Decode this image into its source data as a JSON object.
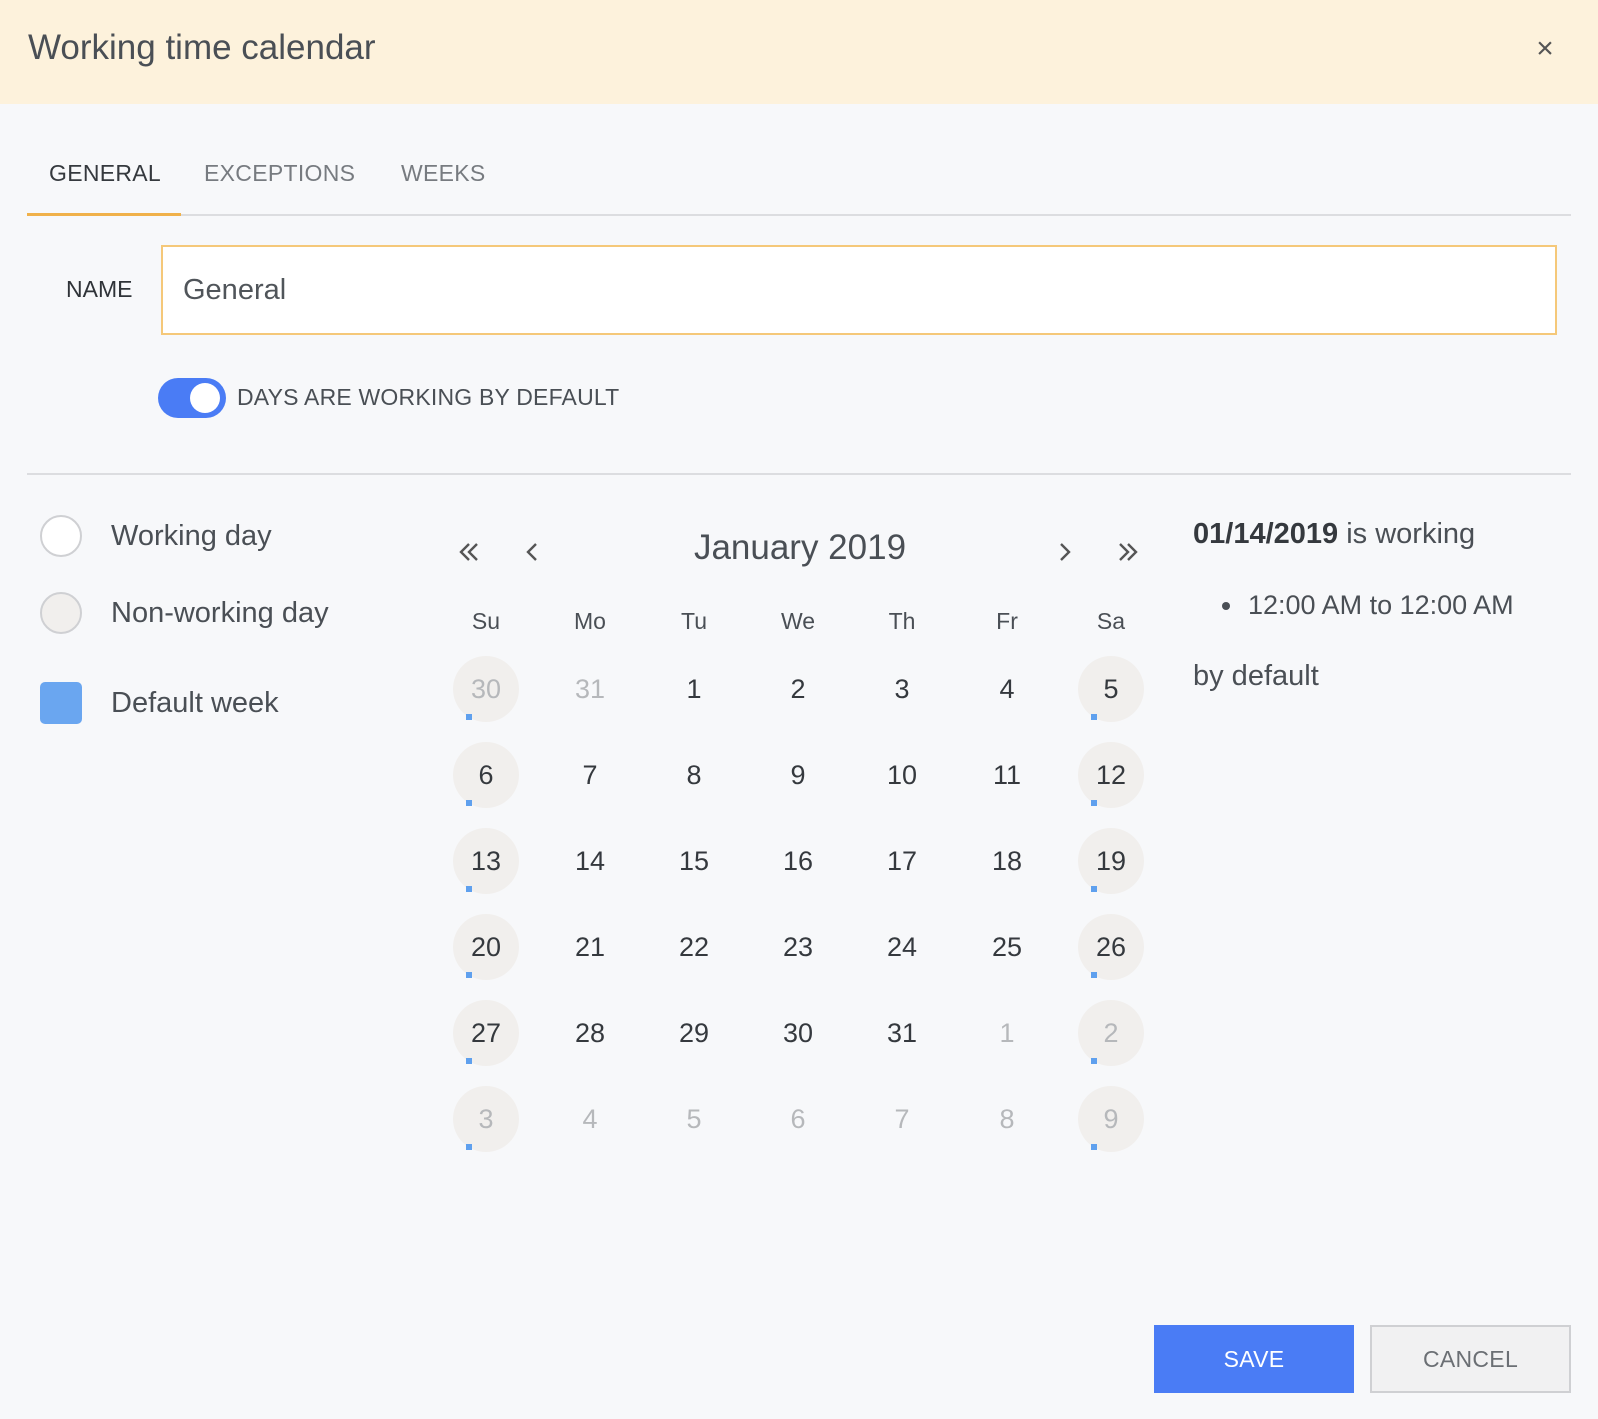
{
  "dialog": {
    "title": "Working time calendar",
    "close_label": "×"
  },
  "tabs": [
    {
      "label": "GENERAL",
      "active": true
    },
    {
      "label": "EXCEPTIONS",
      "active": false
    },
    {
      "label": "WEEKS",
      "active": false
    }
  ],
  "form": {
    "name_label": "NAME",
    "name_value": "General",
    "toggle_label": "DAYS ARE WORKING BY DEFAULT",
    "toggle_on": true
  },
  "legend": [
    {
      "label": "Working day",
      "kind": "working"
    },
    {
      "label": "Non-working day",
      "kind": "nonwork"
    },
    {
      "label": "Default week",
      "kind": "week",
      "color": "#6aa6f0"
    }
  ],
  "calendar": {
    "month_title": "January 2019",
    "nav_icons": [
      "double-chevron-left-icon",
      "chevron-left-icon",
      "chevron-right-icon",
      "double-chevron-right-icon"
    ],
    "weekdays": [
      "Su",
      "Mo",
      "Tu",
      "We",
      "Th",
      "Fr",
      "Sa"
    ],
    "weeks": [
      [
        {
          "d": "30",
          "o": true
        },
        {
          "d": "31",
          "o": true
        },
        {
          "d": "1"
        },
        {
          "d": "2"
        },
        {
          "d": "3"
        },
        {
          "d": "4"
        },
        {
          "d": "5"
        }
      ],
      [
        {
          "d": "6"
        },
        {
          "d": "7"
        },
        {
          "d": "8"
        },
        {
          "d": "9"
        },
        {
          "d": "10"
        },
        {
          "d": "11"
        },
        {
          "d": "12"
        }
      ],
      [
        {
          "d": "13"
        },
        {
          "d": "14"
        },
        {
          "d": "15"
        },
        {
          "d": "16"
        },
        {
          "d": "17"
        },
        {
          "d": "18"
        },
        {
          "d": "19"
        }
      ],
      [
        {
          "d": "20"
        },
        {
          "d": "21"
        },
        {
          "d": "22"
        },
        {
          "d": "23"
        },
        {
          "d": "24"
        },
        {
          "d": "25"
        },
        {
          "d": "26"
        }
      ],
      [
        {
          "d": "27"
        },
        {
          "d": "28"
        },
        {
          "d": "29"
        },
        {
          "d": "30"
        },
        {
          "d": "31"
        },
        {
          "d": "1",
          "o": true
        },
        {
          "d": "2",
          "o": true
        }
      ],
      [
        {
          "d": "3",
          "o": true
        },
        {
          "d": "4",
          "o": true
        },
        {
          "d": "5",
          "o": true
        },
        {
          "d": "6",
          "o": true
        },
        {
          "d": "7",
          "o": true
        },
        {
          "d": "8",
          "o": true
        },
        {
          "d": "9",
          "o": true
        }
      ]
    ]
  },
  "info": {
    "date": "01/14/2019",
    "status": " is working",
    "interval": "12:00 AM to 12:00 AM",
    "note": "by default"
  },
  "buttons": {
    "save": "SAVE",
    "cancel": "CANCEL"
  },
  "colors": {
    "accent": "#4a7cf5",
    "header_bg": "#fdf2dc",
    "tab_underline": "#f0b14a",
    "default_week_marker": "#5fa0ee"
  }
}
